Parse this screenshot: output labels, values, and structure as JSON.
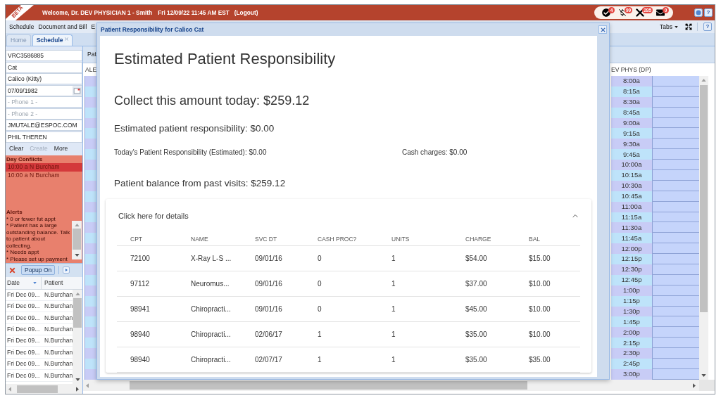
{
  "header": {
    "ribbon": "BETA",
    "welcome": "Welcome, Dr. DEV PHYSICIAN 1 - Smith",
    "datetime": "Fri 12/09/22 11:45 AM EST",
    "logout": "(Logout)",
    "notifications": [
      {
        "kind": "tasks",
        "count": "4"
      },
      {
        "kind": "billing",
        "count": "99"
      },
      {
        "kind": "tools",
        "count": "285"
      },
      {
        "kind": "mail",
        "count": "0"
      }
    ],
    "help": "?"
  },
  "menu": {
    "items": [
      "Schedule",
      "Document and Bill",
      "E"
    ],
    "tabs_button": "Tabs",
    "help": "?"
  },
  "tabs": [
    {
      "label": "Home",
      "selected": false,
      "closable": false
    },
    {
      "label": "Schedule",
      "selected": true,
      "closable": true
    }
  ],
  "patient_form": {
    "fields": [
      {
        "kind": "text",
        "value": "VRC3586885"
      },
      {
        "kind": "text",
        "value": "Cat"
      },
      {
        "kind": "text",
        "value": "Calico (Kitty)"
      },
      {
        "kind": "date",
        "value": "07/09/1982"
      },
      {
        "kind": "text",
        "placeholder": "- Phone 1 -"
      },
      {
        "kind": "text",
        "placeholder": "- Phone 2 -"
      },
      {
        "kind": "text",
        "value": "JMUTALE@ESPOC.COM"
      },
      {
        "kind": "text",
        "value": "PHIL THEREN"
      }
    ],
    "actions": [
      {
        "label": "Clear",
        "disabled": false
      },
      {
        "label": "Create",
        "disabled": true
      },
      {
        "label": "More",
        "disabled": false
      }
    ]
  },
  "day_conflicts": {
    "title": "Day Conflicts",
    "rows": [
      {
        "time": "10:00 a",
        "patient": "N Burcham",
        "selected": true
      },
      {
        "time": "10:00 a",
        "patient": "N Burcham",
        "selected": false
      }
    ]
  },
  "alerts": {
    "title": "Alerts",
    "items": [
      "* 0 or fewer fut appt",
      "* Patient has a large outstanding balance. Talk to patient about collecting.",
      "* Needs appt",
      "* Please set up payment"
    ]
  },
  "list_toolbar": {
    "popup_button": "Popup On"
  },
  "appointments": {
    "columns": [
      "Date",
      "Patient"
    ],
    "rows": [
      {
        "date": "Fri Dec 09...",
        "patient": "N.Burchan"
      },
      {
        "date": "Fri Dec 09...",
        "patient": "N.Burchan"
      },
      {
        "date": "Fri Dec 09...",
        "patient": "N.Burchan"
      },
      {
        "date": "Fri Dec 09...",
        "patient": "N.Burchan"
      },
      {
        "date": "Fri Dec 09...",
        "patient": "N.Burchan"
      },
      {
        "date": "Fri Dec 09...",
        "patient": "N.Burchan"
      },
      {
        "date": "Fri Dec 09...",
        "patient": "N.Burchan"
      },
      {
        "date": "Fri Dec 09...",
        "patient": "N.Burchan"
      }
    ]
  },
  "schedule": {
    "tab_label": "Pat",
    "providers": [
      "ALE",
      "EV PHYS (DP)"
    ],
    "times": [
      "8:00a",
      "8:15a",
      "8:30a",
      "8:45a",
      "9:00a",
      "9:15a",
      "9:30a",
      "9:45a",
      "10:00a",
      "10:15a",
      "10:30a",
      "10:45a",
      "11:00a",
      "11:15a",
      "11:30a",
      "11:45a",
      "12:00p",
      "12:15p",
      "12:30p",
      "12:45p",
      "1:00p",
      "1:15p",
      "1:30p",
      "1:45p",
      "2:00p",
      "2:15p",
      "2:30p",
      "2:45p",
      "3:00p"
    ]
  },
  "dialog": {
    "title": "Patient Responsibility for Calico Cat",
    "heading": "Estimated Patient Responsibility",
    "collect_today": "Collect this amount today: $259.12",
    "estimated_responsibility": "Estimated patient responsibility: $0.00",
    "todays_responsibility": "Today's Patient Responsibility (Estimated): $0.00",
    "cash_charges": "Cash charges: $0.00",
    "past_balance": "Patient balance from past visits: $259.12",
    "details": {
      "label": "Click here for details",
      "expanded": true,
      "columns": [
        "CPT",
        "NAME",
        "SVC DT",
        "CASH PROC?",
        "UNITS",
        "CHARGE",
        "BAL"
      ],
      "rows": [
        [
          "72100",
          "X-Ray L-S ...",
          "09/01/16",
          "0",
          "1",
          "$54.00",
          "$15.00"
        ],
        [
          "97112",
          "Neuromus...",
          "09/01/16",
          "0",
          "1",
          "$37.00",
          "$10.00"
        ],
        [
          "98941",
          "Chiropracti...",
          "09/01/16",
          "0",
          "1",
          "$45.00",
          "$10.00"
        ],
        [
          "98940",
          "Chiropracti...",
          "02/06/17",
          "1",
          "1",
          "$35.00",
          "$10.00"
        ],
        [
          "98940",
          "Chiropracti...",
          "02/07/17",
          "1",
          "1",
          "$35.00",
          "$35.00"
        ]
      ]
    }
  }
}
